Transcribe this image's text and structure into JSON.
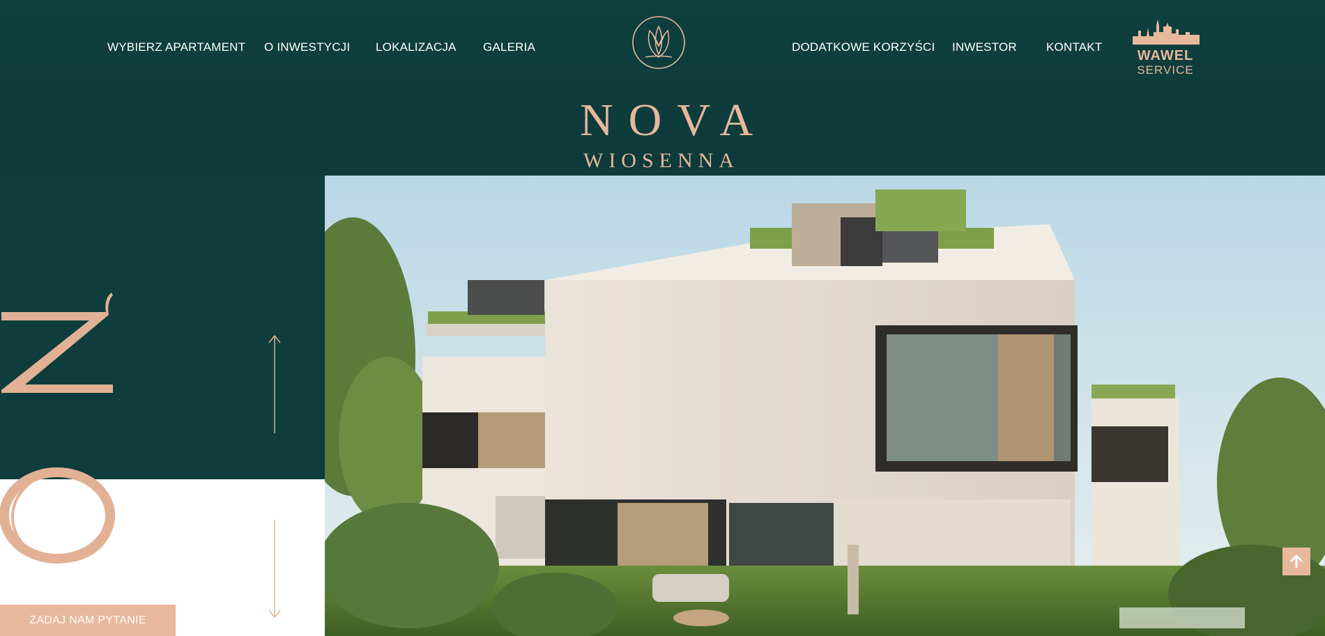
{
  "nav": {
    "left": [
      {
        "label": "WYBIERZ APARTAMENT"
      },
      {
        "label": "O INWESTYCJI"
      },
      {
        "label": "LOKALIZACJA"
      },
      {
        "label": "GALERIA"
      }
    ],
    "right": [
      {
        "label": "DODATKOWE KORZYŚCI"
      },
      {
        "label": "INWESTOR"
      },
      {
        "label": "KONTAKT"
      }
    ]
  },
  "logo": {
    "line1": "NOVA",
    "line2": "WIOSENNA",
    "icon": "crocus-flower-icon"
  },
  "partner": {
    "line1": "WAWEL",
    "line2": "SERVICE",
    "icon": "castle-icon"
  },
  "side_letters": {
    "top": "N",
    "bottom": "O"
  },
  "cta": {
    "ask_label": "ZADAJ NAM PYTANIE"
  },
  "icons": {
    "arrow_up": "arrow-up-icon",
    "arrow_down": "arrow-down-icon",
    "scroll_top": "arrow-up-icon"
  },
  "colors": {
    "dark_teal": "#0f3d3d",
    "accent_peach": "#e7b89c",
    "white": "#ffffff"
  }
}
